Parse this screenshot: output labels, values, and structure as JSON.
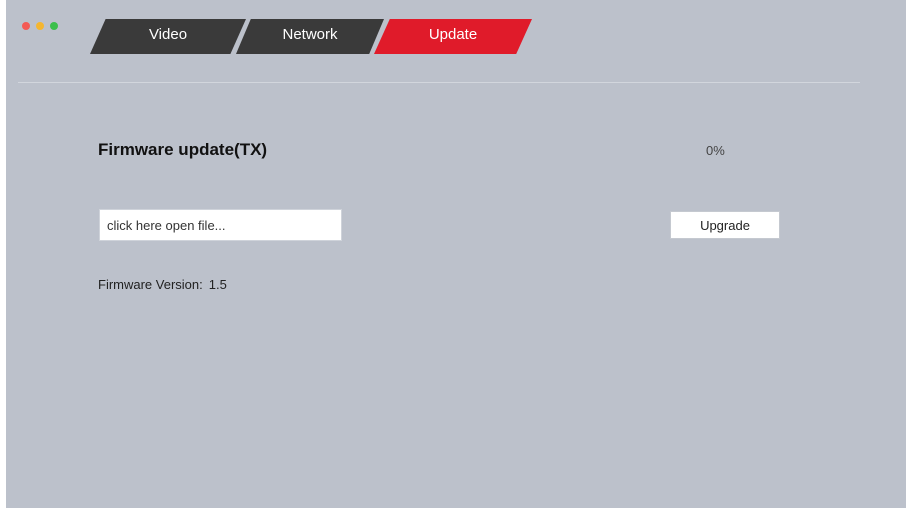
{
  "window_controls": [
    {
      "name": "close",
      "color": "#f45a55"
    },
    {
      "name": "minimize",
      "color": "#f5b62f"
    },
    {
      "name": "maximize",
      "color": "#3bbf4b"
    }
  ],
  "tabs": [
    {
      "label": "Video",
      "active": false
    },
    {
      "label": "Network",
      "active": false
    },
    {
      "label": "Update",
      "active": true
    }
  ],
  "colors": {
    "background": "#bcc1cb",
    "tab_inactive": "#3a3a3a",
    "tab_active": "#e01b2a"
  },
  "firmware": {
    "title": "Firmware update(TX)",
    "progress": "0%",
    "file_placeholder": "click here open file...",
    "upgrade_label": "Upgrade",
    "version_label": "Firmware Version:",
    "version_value": "1.5"
  }
}
